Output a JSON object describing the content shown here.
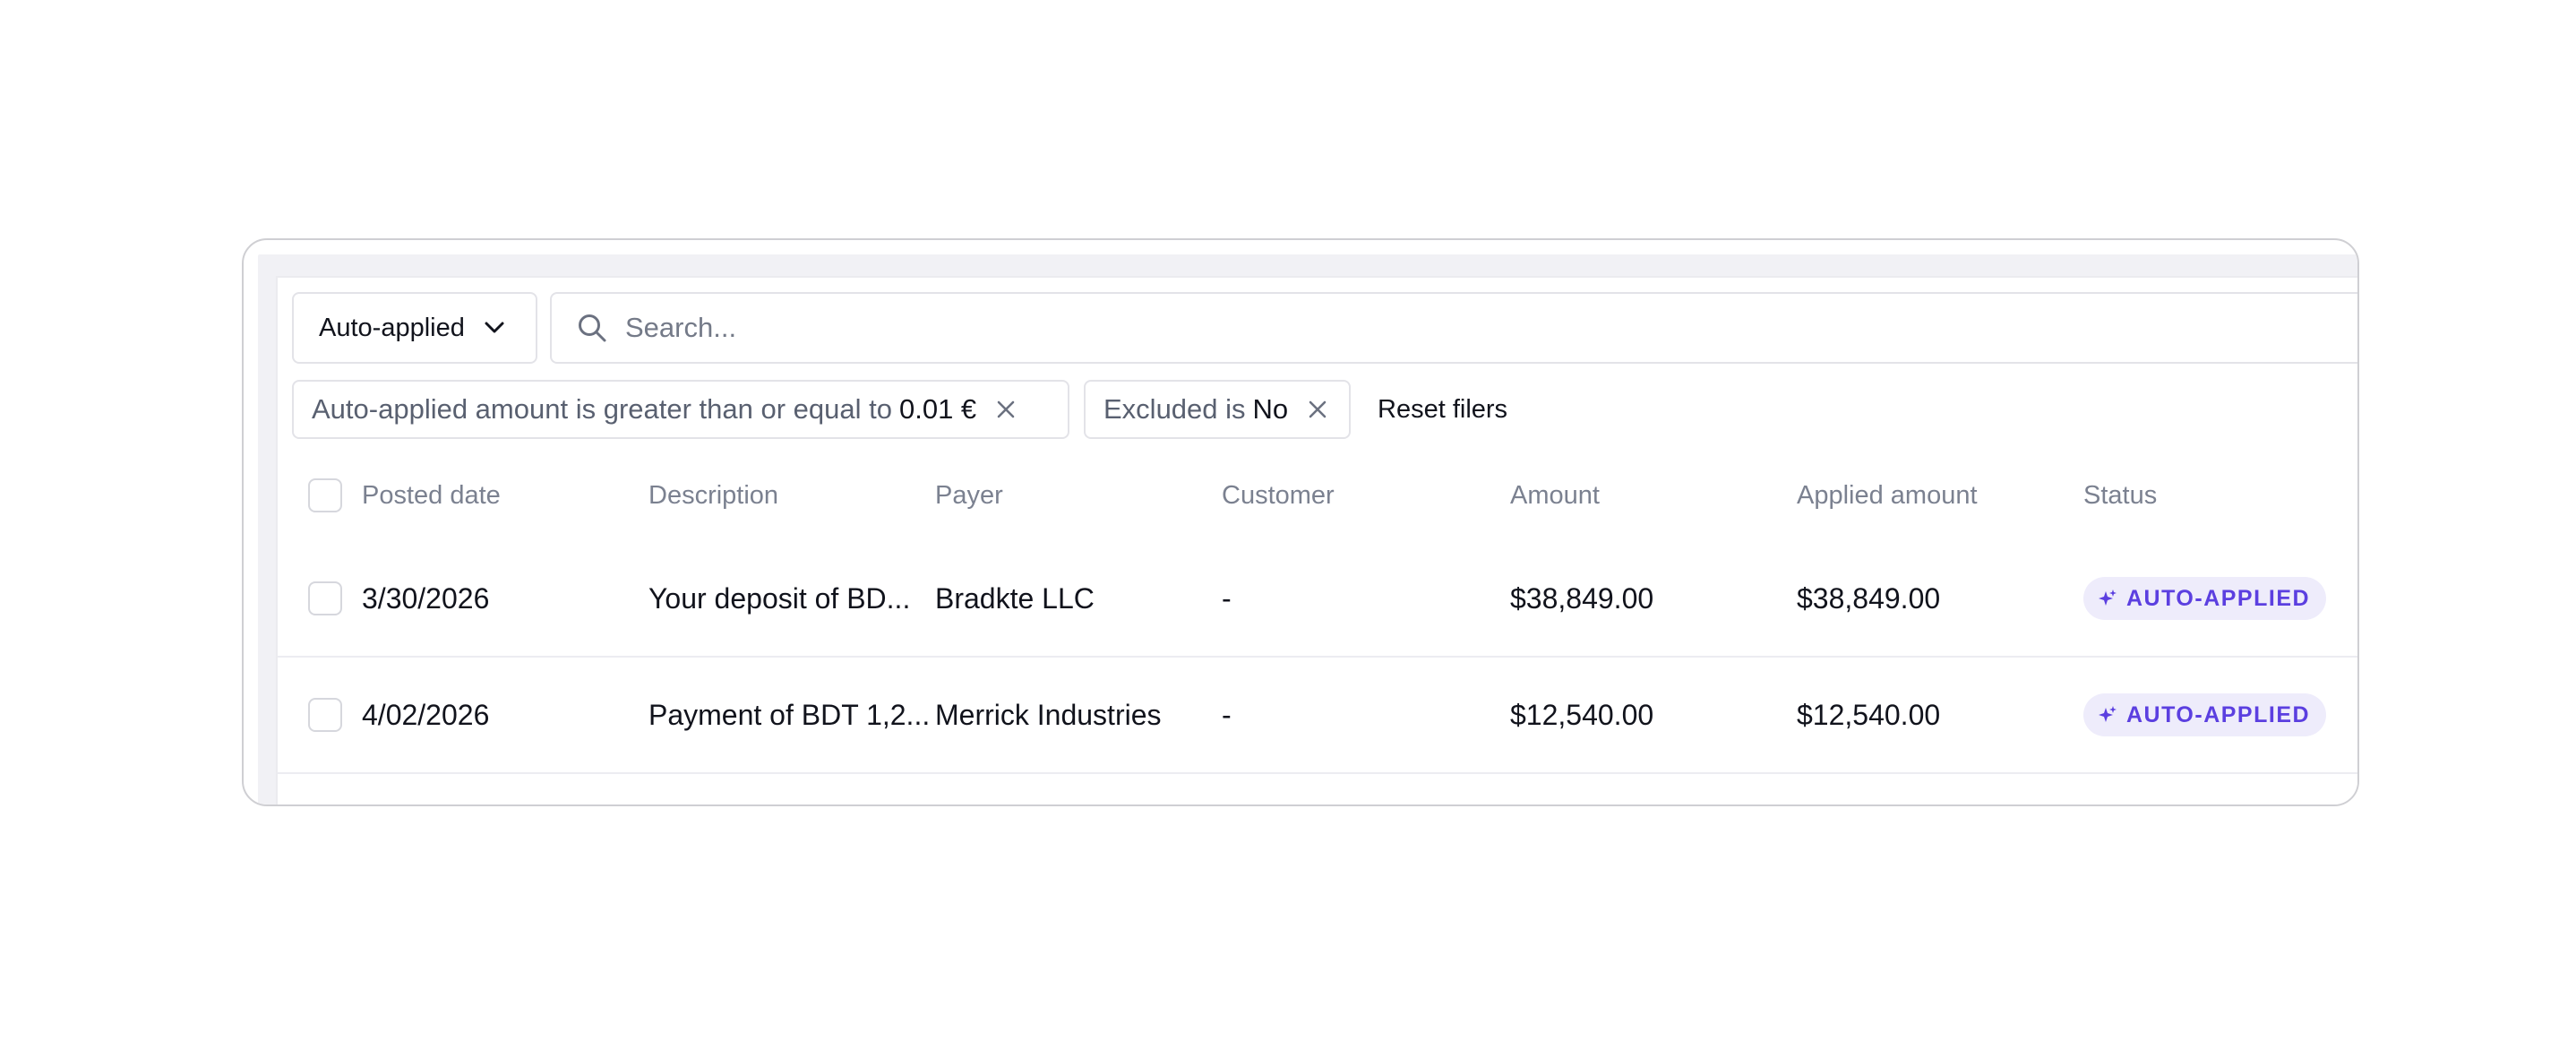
{
  "toolbar": {
    "view_select": "Auto-applied",
    "search_placeholder": "Search..."
  },
  "filters": [
    {
      "label": "Auto-applied amount is greater than or equal to",
      "value": "0.01 €"
    },
    {
      "label": "Excluded is",
      "value": "No"
    }
  ],
  "reset_label": "Reset filers",
  "table": {
    "columns": [
      "Posted date",
      "Description",
      "Payer",
      "Customer",
      "Amount",
      "Applied amount",
      "Status"
    ],
    "rows": [
      {
        "posted_date": "3/30/2026",
        "description": "Your deposit of BD...",
        "payer": "Bradkte LLC",
        "customer": "-",
        "amount": "$38,849.00",
        "applied_amount": "$38,849.00",
        "status": "AUTO-APPLIED"
      },
      {
        "posted_date": "4/02/2026",
        "description": "Payment of BDT 1,2...",
        "payer": "Merrick Industries",
        "customer": "-",
        "amount": "$12,540.00",
        "applied_amount": "$12,540.00",
        "status": "AUTO-APPLIED"
      }
    ]
  },
  "icons": {
    "dropdown": "chevron-down-icon",
    "search": "search-icon",
    "remove_filter": "close-icon",
    "status": "sparkle-icon"
  },
  "colors": {
    "status_text": "#5b3fe0",
    "status_bg": "#eeecfb"
  }
}
